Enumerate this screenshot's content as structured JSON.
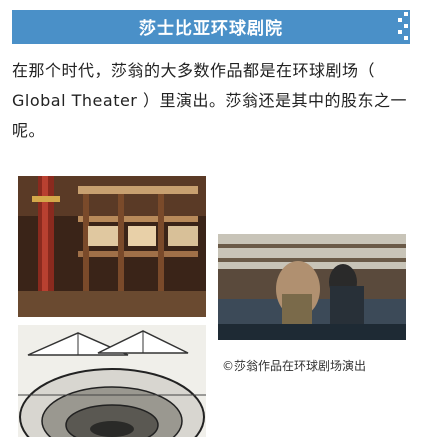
{
  "banner": {
    "title": "莎士比亚环球剧院",
    "color": "#4a90c8"
  },
  "paragraph": "在那个时代，莎翁的大多数作品都是在环球剧场（ Global Theater ）里演出。莎翁还是其中的股东之一呢。",
  "caption": "©莎翁作品在环球剧场演出",
  "images": [
    {
      "name": "globe-theater-interior-photo",
      "subject": "环球剧院内部"
    },
    {
      "name": "globe-theater-performance-photo",
      "subject": "舞台演出"
    },
    {
      "name": "globe-theater-engraving",
      "subject": "剧院版画"
    }
  ]
}
